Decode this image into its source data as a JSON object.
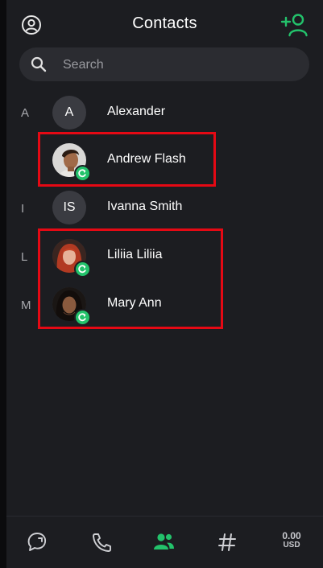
{
  "header": {
    "title": "Contacts"
  },
  "search": {
    "placeholder": "Search"
  },
  "contacts": [
    {
      "letter": "A",
      "name": "Alexander",
      "initials": "A",
      "photo": false
    },
    {
      "letter": "",
      "name": "Andrew Flash",
      "initials": "",
      "photo": true,
      "online": true
    },
    {
      "letter": "I",
      "name": "Ivanna Smith",
      "initials": "IS",
      "photo": false
    },
    {
      "letter": "L",
      "name": "Liliia Liliia",
      "initials": "",
      "photo": true,
      "online": true
    },
    {
      "letter": "M",
      "name": "Mary Ann",
      "initials": "",
      "photo": true,
      "online": true
    }
  ],
  "nav": {
    "items": [
      {
        "icon": "chats-icon"
      },
      {
        "icon": "phone-icon"
      },
      {
        "icon": "contacts-icon",
        "active": true
      },
      {
        "icon": "hash-icon"
      }
    ],
    "balance": {
      "amount": "0.00",
      "currency": "USD"
    }
  },
  "colors": {
    "accent": "#23c26b",
    "highlight": "#e50914",
    "background": "#1c1d21"
  }
}
